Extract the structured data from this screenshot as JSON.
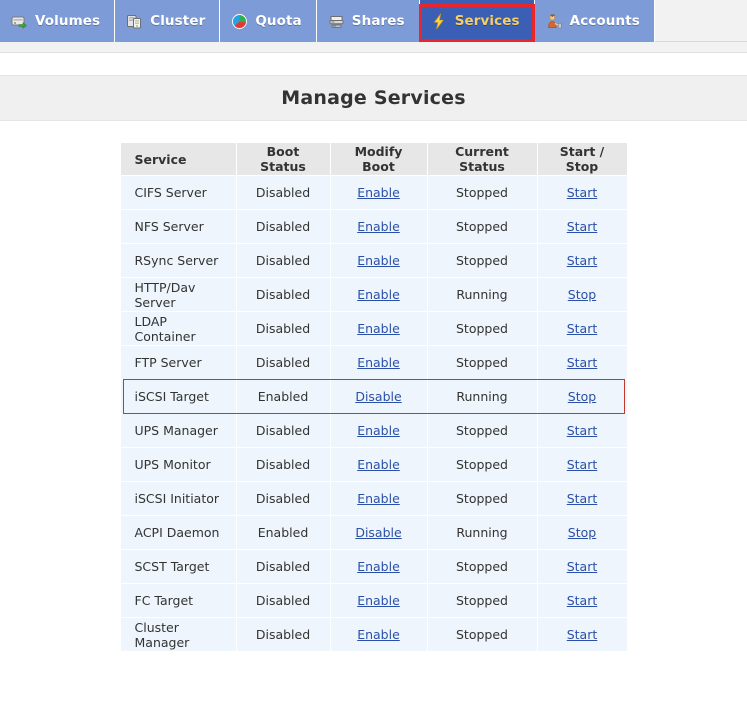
{
  "nav": {
    "tabs": [
      {
        "label": "Volumes",
        "icon": "volumes-icon",
        "active": false
      },
      {
        "label": "Cluster",
        "icon": "cluster-icon",
        "active": false
      },
      {
        "label": "Quota",
        "icon": "quota-icon",
        "active": false
      },
      {
        "label": "Shares",
        "icon": "shares-icon",
        "active": false
      },
      {
        "label": "Services",
        "icon": "services-icon",
        "active": true
      },
      {
        "label": "Accounts",
        "icon": "accounts-icon",
        "active": false
      }
    ]
  },
  "page": {
    "title": "Manage Services"
  },
  "table": {
    "headers": {
      "service": "Service",
      "boot_status": "Boot Status",
      "modify_boot": "Modify Boot",
      "current_status": "Current Status",
      "start_stop": "Start / Stop"
    },
    "rows": [
      {
        "service": "CIFS Server",
        "boot_status": "Disabled",
        "modify_boot": "Enable",
        "current_status": "Stopped",
        "start_stop": "Start",
        "highlighted": false
      },
      {
        "service": "NFS Server",
        "boot_status": "Disabled",
        "modify_boot": "Enable",
        "current_status": "Stopped",
        "start_stop": "Start",
        "highlighted": false
      },
      {
        "service": "RSync Server",
        "boot_status": "Disabled",
        "modify_boot": "Enable",
        "current_status": "Stopped",
        "start_stop": "Start",
        "highlighted": false
      },
      {
        "service": "HTTP/Dav Server",
        "boot_status": "Disabled",
        "modify_boot": "Enable",
        "current_status": "Running",
        "start_stop": "Stop",
        "highlighted": false
      },
      {
        "service": "LDAP Container",
        "boot_status": "Disabled",
        "modify_boot": "Enable",
        "current_status": "Stopped",
        "start_stop": "Start",
        "highlighted": false
      },
      {
        "service": "FTP Server",
        "boot_status": "Disabled",
        "modify_boot": "Enable",
        "current_status": "Stopped",
        "start_stop": "Start",
        "highlighted": false
      },
      {
        "service": "iSCSI Target",
        "boot_status": "Enabled",
        "modify_boot": "Disable",
        "current_status": "Running",
        "start_stop": "Stop",
        "highlighted": true
      },
      {
        "service": "UPS Manager",
        "boot_status": "Disabled",
        "modify_boot": "Enable",
        "current_status": "Stopped",
        "start_stop": "Start",
        "highlighted": false
      },
      {
        "service": "UPS Monitor",
        "boot_status": "Disabled",
        "modify_boot": "Enable",
        "current_status": "Stopped",
        "start_stop": "Start",
        "highlighted": false
      },
      {
        "service": "iSCSI Initiator",
        "boot_status": "Disabled",
        "modify_boot": "Enable",
        "current_status": "Stopped",
        "start_stop": "Start",
        "highlighted": false
      },
      {
        "service": "ACPI Daemon",
        "boot_status": "Enabled",
        "modify_boot": "Disable",
        "current_status": "Running",
        "start_stop": "Stop",
        "highlighted": false
      },
      {
        "service": "SCST Target",
        "boot_status": "Disabled",
        "modify_boot": "Enable",
        "current_status": "Stopped",
        "start_stop": "Start",
        "highlighted": false
      },
      {
        "service": "FC Target",
        "boot_status": "Disabled",
        "modify_boot": "Enable",
        "current_status": "Stopped",
        "start_stop": "Start",
        "highlighted": false
      },
      {
        "service": "Cluster Manager",
        "boot_status": "Disabled",
        "modify_boot": "Enable",
        "current_status": "Stopped",
        "start_stop": "Start",
        "highlighted": false
      }
    ]
  },
  "colors": {
    "nav_tab": "#7d9bd6",
    "nav_tab_active": "#3b5fb5",
    "nav_tab_active_text": "#f5cf62",
    "highlight_border": "#e8262b",
    "row_highlight_border": "#c0392b",
    "state_off": "#f7cc5e",
    "state_on": "#ddeeb5",
    "cell_default": "#eef5fc",
    "header_cell": "#e7e7e7",
    "link": "#2b50a8"
  }
}
